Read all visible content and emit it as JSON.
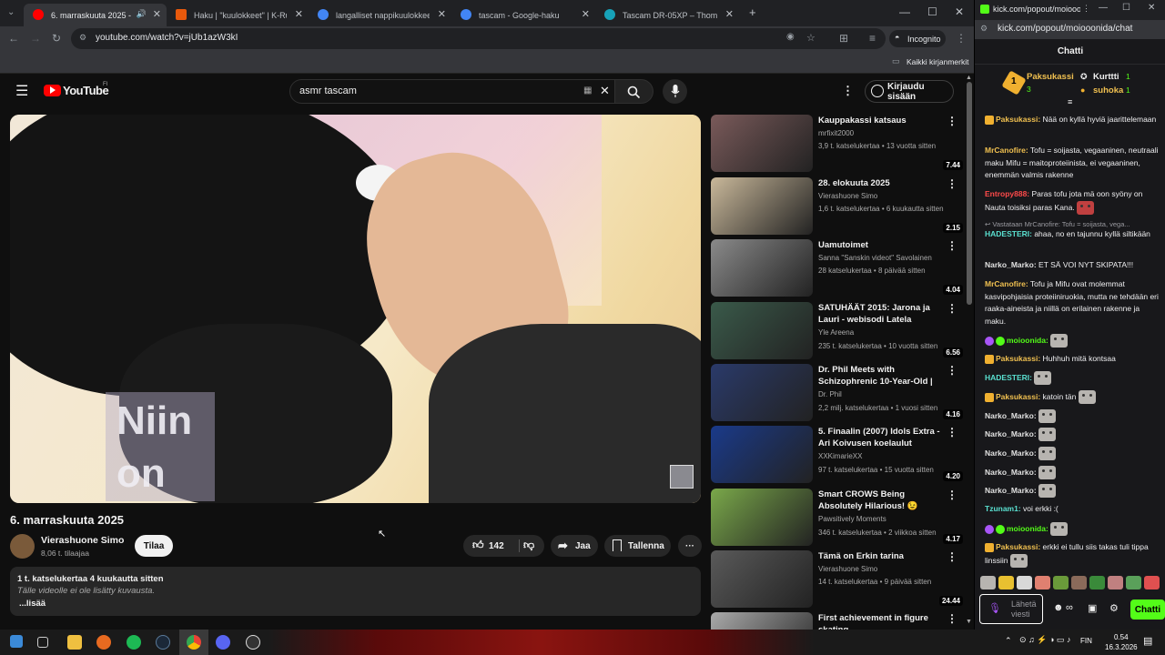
{
  "browser": {
    "tabs": [
      {
        "title": "6. marraskuuta 2025 - YouTube",
        "active": true,
        "color": "#ff0000"
      },
      {
        "title": "Haku | \"kuulokkeet\" | K-Ruoka",
        "color": "#e8590c"
      },
      {
        "title": "langalliset nappikuulokkeet - Google",
        "color": "#4285f4"
      },
      {
        "title": "tascam - Google-haku",
        "color": "#4285f4"
      },
      {
        "title": "Tascam DR-05XP – Thomann Suomi",
        "color": "#17a2b8"
      }
    ],
    "new_tab": "+",
    "url": "youtube.com/watch?v=jUb1azW3kI",
    "incognito_label": "Incognito",
    "bookmarks_label": "Kaikki kirjanmerkit"
  },
  "youtube": {
    "logo_text": "YouTube",
    "region": "FI",
    "search_value": "asmr tascam",
    "signin_label": "Kirjaudu sisään",
    "overlay_text_1": "Niin",
    "overlay_text_2": "on",
    "video_title": "6. marraskuuta 2025",
    "channel_name": "Vierashuone Simo",
    "subscribers": "8,06 t. tilaajaa",
    "subscribe_label": "Tilaa",
    "likes": "142",
    "share_label": "Jaa",
    "save_label": "Tallenna",
    "desc_meta": "1 t. katselukertaa  4 kuukautta sitten",
    "desc_text": "Tälle videolle ei ole lisätty kuvausta.",
    "desc_more": "...lisää",
    "recommendations": [
      {
        "title": "Kauppakassi katsaus",
        "channel": "mrfixit2000",
        "meta": "3,9 t. katselukertaa • 13 vuotta sitten",
        "duration": "7.44",
        "thumb": "#7a5a5a"
      },
      {
        "title": "28. elokuuta 2025",
        "channel": "Vierashuone Simo",
        "meta": "1,6 t. katselukertaa • 6 kuukautta sitten",
        "duration": "2.15",
        "thumb": "#c9b89a"
      },
      {
        "title": "Uamutoimet",
        "channel": "Sanna \"Sanskin videot\" Savolainen",
        "meta": "28 katselukertaa • 8 päivää sitten",
        "duration": "4.04",
        "thumb": "#8a8a8a"
      },
      {
        "title": "SATUHÄÄT 2015: Jarona ja Lauri - webisodi Latela",
        "channel": "Yle Areena",
        "meta": "235 t. katselukertaa • 10 vuotta sitten",
        "duration": "6.56",
        "thumb": "#3a5a4a"
      },
      {
        "title": "Dr. Phil Meets with Schizophrenic 10-Year-Old | Dr...",
        "channel": "Dr. Phil",
        "meta": "2,2 milj. katselukertaa • 1 vuosi sitten",
        "duration": "4.16",
        "thumb": "#2a3a6a"
      },
      {
        "title": "5. Finaalin (2007) Idols Extra - Ari Koivusen koelaulut",
        "channel": "XXKimarieXX",
        "meta": "97 t. katselukertaa • 15 vuotta sitten",
        "duration": "4.20",
        "thumb": "#1a3a8a"
      },
      {
        "title": "Smart CROWS Being Absolutely Hilarious! 😉 Funniest Crow ...",
        "channel": "Pawsitively Moments",
        "meta": "346 t. katselukertaa • 2 viikkoa sitten",
        "duration": "4.17",
        "thumb": "#7aa84a"
      },
      {
        "title": "Tämä on Erkin tarina",
        "channel": "Vierashuone Simo",
        "meta": "14 t. katselukertaa • 9 päivää sitten",
        "duration": "24.44",
        "thumb": "#5a5a5a"
      },
      {
        "title": "First achievement in figure skating",
        "channel": "",
        "meta": "",
        "duration": "",
        "thumb": "#aaaaaa"
      }
    ]
  },
  "chat": {
    "window_url_short": "kick.com/popout/moiooonid...",
    "url": "kick.com/popout/moiooonida/chat",
    "header": "Chatti",
    "leaders": [
      {
        "rank": "1",
        "name": "Paksukassi",
        "count": "3"
      },
      {
        "name": "Kurttti",
        "count": "1"
      },
      {
        "name": "suhoka",
        "count": "1"
      }
    ],
    "messages": [
      {
        "user": "Paksukassi:",
        "text": " Nää on kyllä hyviä jaarittelemaan",
        "color": "#f0c050"
      },
      {
        "user": "MrCanofire:",
        "text": " Tofu = soijasta, vegaaninen, neutraali maku Mifu = maitoproteiinista, ei vegaaninen, enemmän valmis rakenne",
        "color": "#f0c050"
      },
      {
        "user": "Entropy888:",
        "text": " Paras tofu jota mä oon syöny on Nauta toisiksi paras Kana.",
        "color": "#ff4a4a"
      },
      {
        "reply": "Vastataan MrCanofire: Tofu = soijasta, vega..."
      },
      {
        "user": "HADESTERI:",
        "text": " ahaa, no en tajunnu kyllä siltikään",
        "color": "#5ae0d0"
      },
      {
        "user": "Narko_Marko:",
        "text": " ET SÄ VOI NYT SKIPATA!!!",
        "color": "#e0e0e0"
      },
      {
        "user": "MrCanofire:",
        "text": " Tofu ja Mifu ovat molemmat kasvipohjaisia proteiiniruokia, mutta ne tehdään eri raaka-aineista ja niillä on erilainen rakenne ja maku.",
        "color": "#f0c050"
      },
      {
        "user": "moioonida:",
        "text": "",
        "color": "#53fc18"
      },
      {
        "user": "Paksukassi:",
        "text": " Huhhuh mitä kontsaa",
        "color": "#f0c050"
      },
      {
        "user": "HADESTERI:",
        "text": "",
        "color": "#5ae0d0"
      },
      {
        "user": "Paksukassi:",
        "text": " katoin tän",
        "color": "#f0c050"
      },
      {
        "user": "Narko_Marko:",
        "text": "",
        "color": "#e0e0e0"
      },
      {
        "user": "Narko_Marko:",
        "text": "",
        "color": "#e0e0e0"
      },
      {
        "user": "Narko_Marko:",
        "text": "",
        "color": "#e0e0e0"
      },
      {
        "user": "Narko_Marko:",
        "text": "",
        "color": "#e0e0e0"
      },
      {
        "user": "Narko_Marko:",
        "text": "",
        "color": "#e0e0e0"
      },
      {
        "user": "Tzunam1:",
        "text": " voi erkki :(",
        "color": "#5ae0d0"
      },
      {
        "user": "moioonida:",
        "text": "",
        "color": "#53fc18"
      },
      {
        "user": "Paksukassi:",
        "text": " erkki ei tullu siis takas tuli tippa linssiin",
        "color": "#f0c050"
      }
    ],
    "input_placeholder": "Lähetä viesti",
    "send_label": "Chatti"
  },
  "taskbar": {
    "lang": "FIN",
    "time": "0.54",
    "date": "16.3.2026"
  }
}
